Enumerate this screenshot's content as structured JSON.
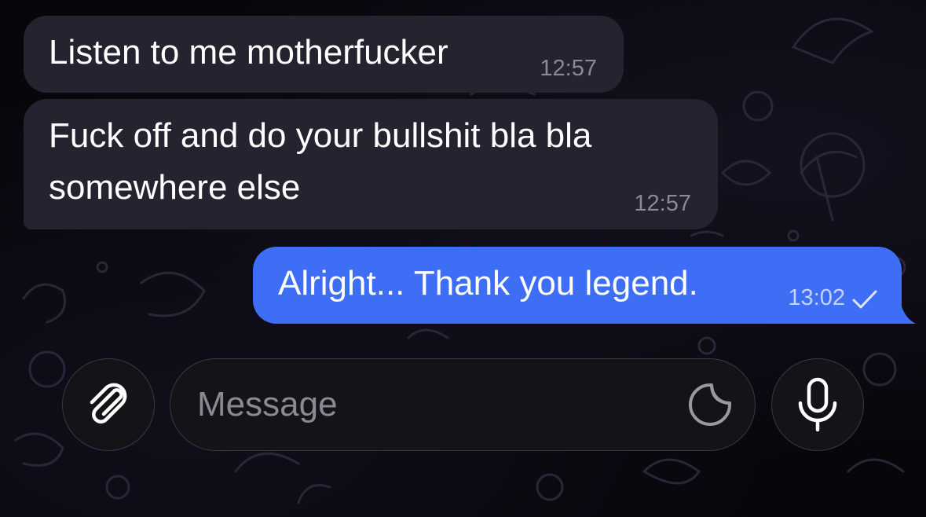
{
  "messages": [
    {
      "direction": "incoming",
      "text": "Listen to me motherfucker",
      "time": "12:57"
    },
    {
      "direction": "incoming",
      "text": "Fuck off and do your bullshit bla bla somewhere else",
      "time": "12:57"
    },
    {
      "direction": "outgoing",
      "text": "Alright... Thank you legend.",
      "time": "13:02",
      "status_icon": "single-check-icon"
    }
  ],
  "composer": {
    "placeholder": "Message",
    "value": "",
    "left_button_icon": "paperclip-icon",
    "sticker_icon": "sticker-icon",
    "right_button_icon": "microphone-icon"
  },
  "colors": {
    "incoming_bubble": "#27222f",
    "outgoing_bubble": "#3d6ef5",
    "background": "#07060b"
  }
}
